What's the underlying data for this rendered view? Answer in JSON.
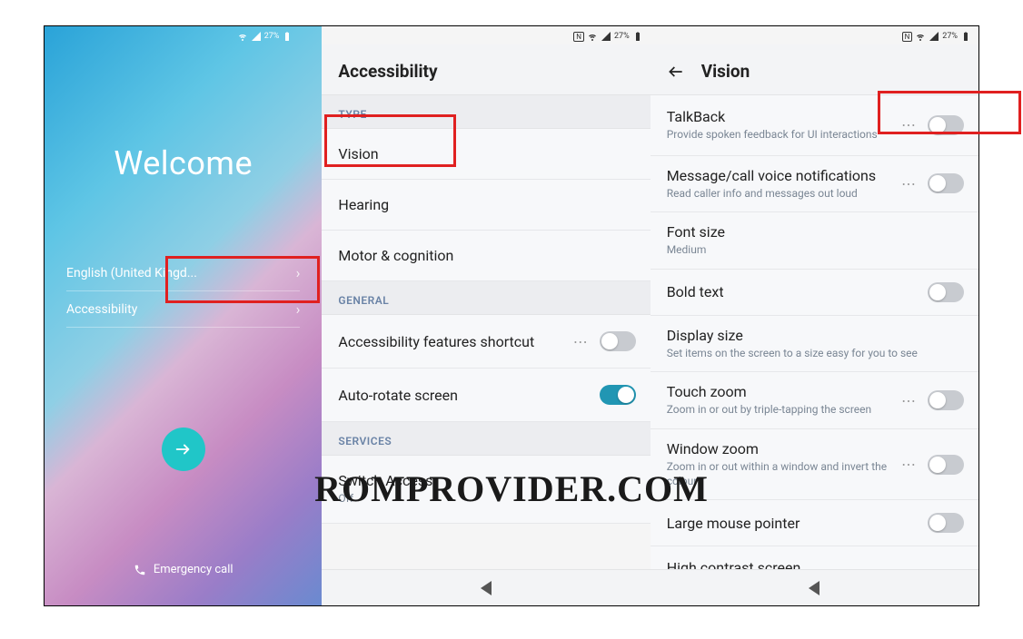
{
  "status": {
    "battery": "27%"
  },
  "welcome": {
    "title": "Welcome",
    "language": "English (United Kingd...",
    "accessibility": "Accessibility",
    "emergency": "Emergency call"
  },
  "accessibility": {
    "title": "Accessibility",
    "sections": {
      "type": "TYPE",
      "general": "GENERAL",
      "services": "SERVICES"
    },
    "items": {
      "vision": "Vision",
      "hearing": "Hearing",
      "motor": "Motor & cognition",
      "features_shortcut": "Accessibility features shortcut",
      "autorotate": "Auto-rotate screen",
      "switch_access": {
        "label": "Switch Access",
        "sub": "Off"
      }
    }
  },
  "vision": {
    "title": "Vision",
    "items": {
      "talkback": {
        "label": "TalkBack",
        "sub": "Provide spoken feedback for UI interactions"
      },
      "msg_voice": {
        "label": "Message/call voice notifications",
        "sub": "Read caller info and messages out loud"
      },
      "font_size": {
        "label": "Font size",
        "sub": "Medium"
      },
      "bold_text": {
        "label": "Bold text"
      },
      "display_size": {
        "label": "Display size",
        "sub": "Set items on the screen to a size easy for you to see"
      },
      "touch_zoom": {
        "label": "Touch zoom",
        "sub": "Zoom in or out by triple-tapping the screen"
      },
      "window_zoom": {
        "label": "Window zoom",
        "sub": "Zoom in or out within a window and invert the colour"
      },
      "large_mouse": {
        "label": "Large mouse pointer"
      },
      "high_contrast": {
        "label": "High contrast screen"
      }
    }
  },
  "watermark": "ROMPROVIDER.COM"
}
